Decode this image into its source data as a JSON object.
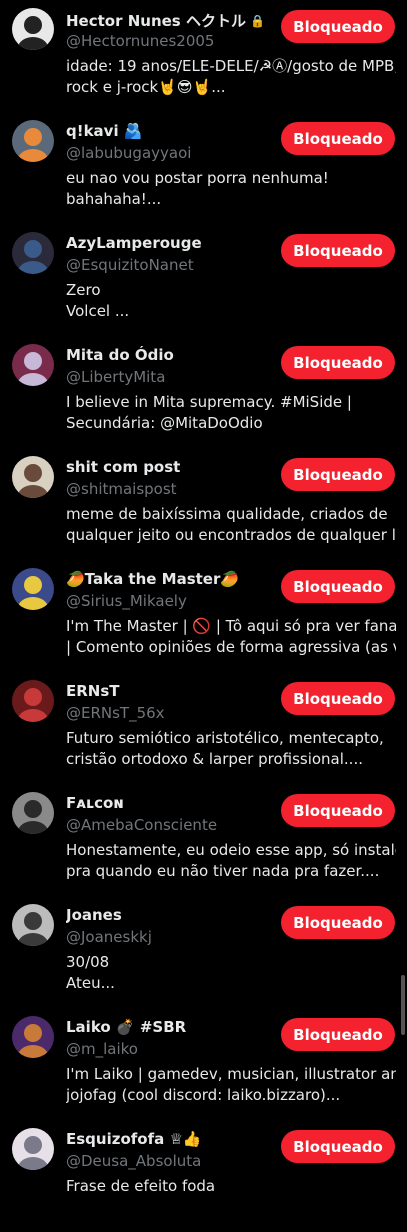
{
  "accent_color": "#f4212e",
  "button_label": "Bloqueado",
  "users": [
    {
      "name": "Hector Nunes ヘクトル",
      "locked": true,
      "handle": "@Hectornunes2005",
      "bio": [
        "idade: 19 anos/ELE-DELE/☭Ⓐ/gosto de MPB,",
        "rock e j-rock🤘😎🤘..."
      ]
    },
    {
      "name": "q!kavi 🫂",
      "handle": "@labubugayyaoi",
      "bio": [
        "eu nao vou postar porra nenhuma!",
        "bahahaha!..."
      ]
    },
    {
      "name": "AzyLamperouge",
      "handle": "@EsquizitoNanet",
      "bio": [
        "Zero",
        "Volcel ..."
      ]
    },
    {
      "name": "Mita do Ódio",
      "handle": "@LibertyMita",
      "bio": [
        "I believe in Mita supremacy. #MiSide |",
        "Secundária: @MitaDoOdio"
      ]
    },
    {
      "name": "shit com post",
      "handle": "@shitmaispost",
      "bio": [
        "meme de baixíssima qualidade, criados de",
        "qualquer jeito ou encontrados de qualquer l..."
      ]
    },
    {
      "name": "🥭Taka the Master🥭",
      "handle": "@Sirius_Mikaely",
      "bio": [
        "I'm The Master | 🚫 | Tô aqui só pra ver fanart",
        "| Comento opiniões de forma agressiva (as v..."
      ]
    },
    {
      "name": "ERNsT",
      "handle": "@ERNsT_56x",
      "bio": [
        "Futuro semiótico aristotélico, mentecapto,",
        "cristão ortodoxo & larper profissional...."
      ]
    },
    {
      "name": "Fᴀʟᴄᴏɴ",
      "handle": "@AmebaConsciente",
      "bio": [
        "Honestamente, eu odeio esse app, só instalei",
        "pra quando eu não tiver nada pra fazer...."
      ]
    },
    {
      "name": "Joanes",
      "handle": "@Joaneskkj",
      "bio": [
        "30/08",
        "Ateu..."
      ]
    },
    {
      "name": "Laiko 💣 #SBR",
      "handle": "@m_laiko",
      "bio": [
        "I'm Laiko | gamedev, musician, illustrator and",
        "jojofag  (cool discord: laiko.bizzaro)..."
      ]
    },
    {
      "name": "Esquizofofa ♕👍",
      "handle": "@Deusa_Absoluta",
      "bio": [
        "Frase de efeito foda"
      ]
    }
  ]
}
